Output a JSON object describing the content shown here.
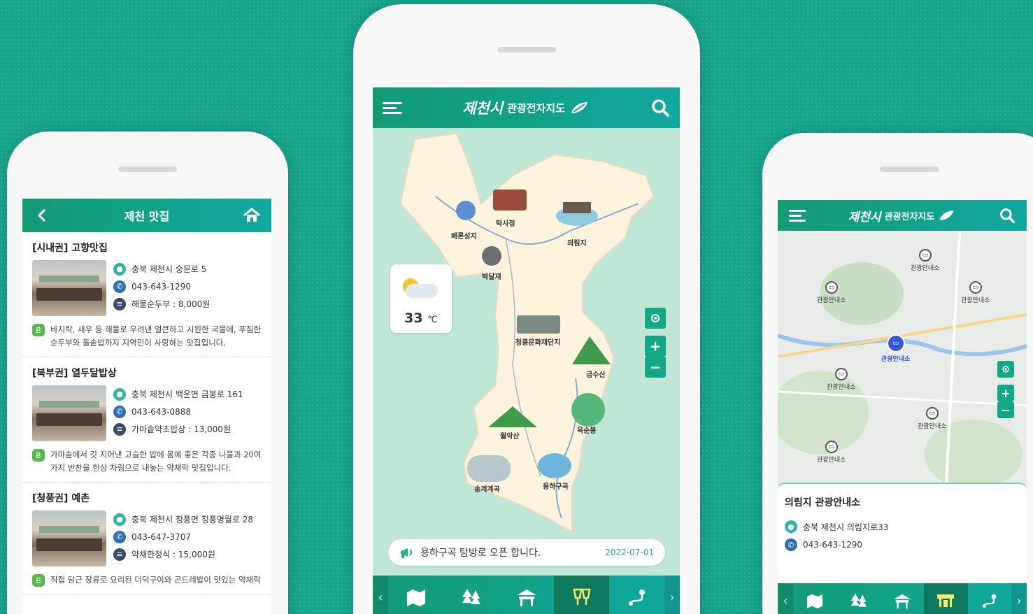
{
  "left_phone": {
    "header_title": "제천 맛집",
    "restaurants": [
      {
        "name": "[시내권] 고향맛집",
        "address": "충북 제천시 숭문로 5",
        "phone": "043-643-1290",
        "menu": "해물순두부 : 8,000원",
        "description": "바지락, 새우 등 해물로 우려낸 얼큰하고 시원한 국물에, 푸짐한 순두부와 돌솥밥까지 지역민이 사랑하는 맛집입니다."
      },
      {
        "name": "[북부권] 열두달밥상",
        "address": "충북 제천시 백운면 금봉로 161",
        "phone": "043-643-0888",
        "menu": "가마솥약초밥상 : 13,000원",
        "description": "가마솥에서 갓 지어낸 고슬한 밥에 몸에 좋은 각종 나물과 20여 가지 반찬을 한상 차림으로 내놓는 약채락 맛집입니다."
      },
      {
        "name": "[청풍권] 예촌",
        "address": "충북 제천시 청풍면 청풍명월로 28",
        "phone": "043-647-3707",
        "menu": "약채한정식 : 15,000원",
        "description": "직접 담근 장류로 요리된 더덕구이와 곤드레밥이 맛있는 약채락"
      }
    ]
  },
  "center_phone": {
    "brand": "제천시",
    "title": "관광전자지도",
    "weather_temp": "33",
    "weather_unit": "℃",
    "places": [
      "배론성지",
      "탁사정",
      "의림지",
      "박달재",
      "청풍문화재단지",
      "금수산",
      "옥순봉",
      "월악산",
      "송계계곡",
      "용하구곡"
    ],
    "notice_text": "용하구곡 탐방로 오픈 합니다.",
    "notice_date": "2022-07-01",
    "zoom_in": "+",
    "zoom_out": "−"
  },
  "right_phone": {
    "brand": "제천시",
    "title": "관광전자지도",
    "poi_label": "관광안내소",
    "poi_selected_label": "관광안내소",
    "detail_title": "의림지 관광안내소",
    "detail_address": "충북 제천시 의림지로33",
    "detail_phone": "043-643-1290",
    "zoom_in": "+",
    "zoom_out": "−"
  },
  "colors": {
    "brand_green": "#13a785",
    "background": "#17a58c",
    "active_tab": "#0d7a5d"
  },
  "icons": [
    "hamburger-menu-icon",
    "search-icon",
    "back-arrow-icon",
    "home-icon",
    "map-icon",
    "tree-icon",
    "pavilion-icon",
    "food-icon",
    "route-icon",
    "locate-icon",
    "megaphone-icon"
  ]
}
